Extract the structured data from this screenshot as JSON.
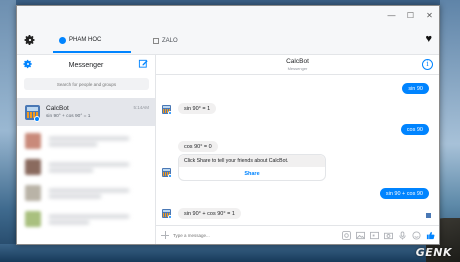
{
  "desktop": {
    "watermark": "GENK"
  },
  "window": {
    "controls": {
      "minimize": "—",
      "maximize": "☐",
      "close": "✕"
    }
  },
  "tabs": [
    {
      "label": "PHAM HOC",
      "active": true
    },
    {
      "label": "ZALO",
      "active": false
    }
  ],
  "sidebar": {
    "title": "Messenger",
    "search_placeholder": "Search for people and groups",
    "conversation": {
      "name": "CalcBot",
      "time": "5:14AM",
      "snippet": "sin 90° + cos 90° = 1"
    }
  },
  "chat": {
    "name": "CalcBot",
    "status": "Messenger",
    "messages": [
      {
        "dir": "out",
        "text": "sin 90"
      },
      {
        "dir": "in",
        "text": "sin 90° = 1"
      },
      {
        "dir": "out",
        "text": "cos 90"
      },
      {
        "dir": "in",
        "text": "cos 90° = 0"
      },
      {
        "dir": "in",
        "text": "Click Share to tell your friends about CalcBot."
      },
      {
        "dir": "out",
        "text": "sin 90 + cos 90"
      },
      {
        "dir": "in",
        "text": "sin 90° + cos 90° = 1"
      }
    ],
    "share_label": "Share",
    "composer_placeholder": "Type a message..."
  },
  "colors": {
    "accent": "#0084ff",
    "incoming_bubble": "#f1f0f0",
    "selected_row": "#e4e6eb"
  }
}
